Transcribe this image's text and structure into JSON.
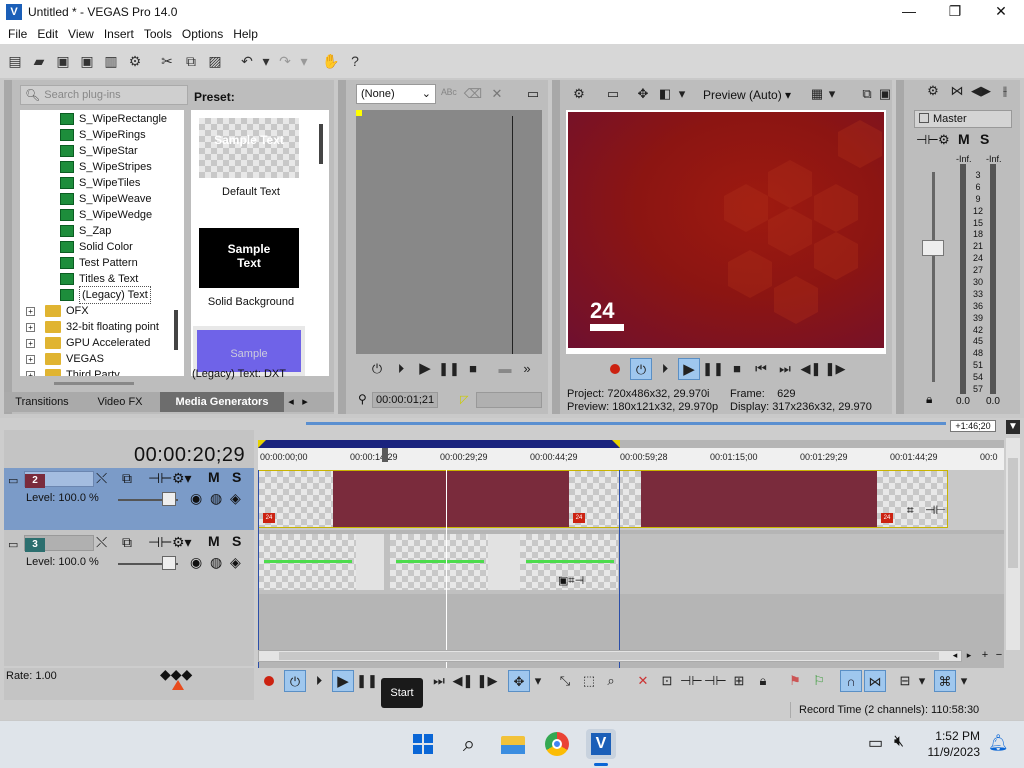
{
  "window": {
    "title": "Untitled * - VEGAS Pro 14.0"
  },
  "menu": [
    "File",
    "Edit",
    "View",
    "Insert",
    "Tools",
    "Options",
    "Help"
  ],
  "plugins": {
    "search_placeholder": "Search plug-ins",
    "preset_label": "Preset:",
    "tree": [
      "S_WipeRectangle",
      "S_WipeRings",
      "S_WipeStar",
      "S_WipeStripes",
      "S_WipeTiles",
      "S_WipeWeave",
      "S_WipeWedge",
      "S_Zap",
      "Solid Color",
      "Test Pattern",
      "Titles & Text",
      "(Legacy) Text"
    ],
    "folders": [
      "OFX",
      "32-bit floating point",
      "GPU Accelerated",
      "VEGAS",
      "Third Party"
    ],
    "presets": [
      {
        "thumb_text": "Sample Text",
        "label": "Default Text"
      },
      {
        "thumb_text": "Sample Text",
        "label": "Solid Background"
      },
      {
        "thumb_text": "Sample",
        "label": "(Legacy) Text: DXT"
      }
    ],
    "tabs": [
      "Transitions",
      "Video FX",
      "Media Generators"
    ]
  },
  "trimmer": {
    "select_value": "(None)",
    "timecode": "00:00:01;21"
  },
  "preview": {
    "quality": "Preview (Auto)",
    "project_label": "Project:",
    "project_value": "720x486x32, 29.970i",
    "preview_label": "Preview:",
    "preview_value": "180x121x32, 29.970p",
    "frame_label": "Frame:",
    "frame_value": "629",
    "display_label": "Display:",
    "display_value": "317x236x32, 29.970",
    "logo_text": "24"
  },
  "mixer": {
    "master_label": "Master",
    "inf_left": "-Inf.",
    "inf_right": "-Inf.",
    "scale": [
      "3",
      "6",
      "9",
      "12",
      "15",
      "18",
      "21",
      "24",
      "27",
      "30",
      "33",
      "36",
      "39",
      "42",
      "45",
      "48",
      "51",
      "54",
      "57"
    ],
    "val_left": "0.0",
    "val_right": "0.0",
    "m_label": "M",
    "s_label": "S"
  },
  "timeline": {
    "timecode": "00:00:20;29",
    "ruler": [
      "00:00:00;00",
      "00:00:14;29",
      "00:00:29;29",
      "00:00:44;29",
      "00:00:59;28",
      "00:01:15;00",
      "00:01:29;29",
      "00:01:44;29",
      "00:0"
    ],
    "end_time": "+1:46;20",
    "tracks": [
      {
        "number": "2",
        "level": "Level: 100.0 %",
        "m": "M",
        "s": "S"
      },
      {
        "number": "3",
        "level": "Level: 100.0 %",
        "m": "M",
        "s": "S"
      }
    ],
    "rate": "Rate: 1.00",
    "tooltip": "Start",
    "record_time": "Record Time (2 channels): 110:58:30"
  },
  "taskbar": {
    "time": "1:52 PM",
    "date": "11/9/2023"
  },
  "colors": {
    "accent": "#2b4ea8",
    "clip_red": "#7a2b3c",
    "track_selected": "#7b9bc8"
  }
}
